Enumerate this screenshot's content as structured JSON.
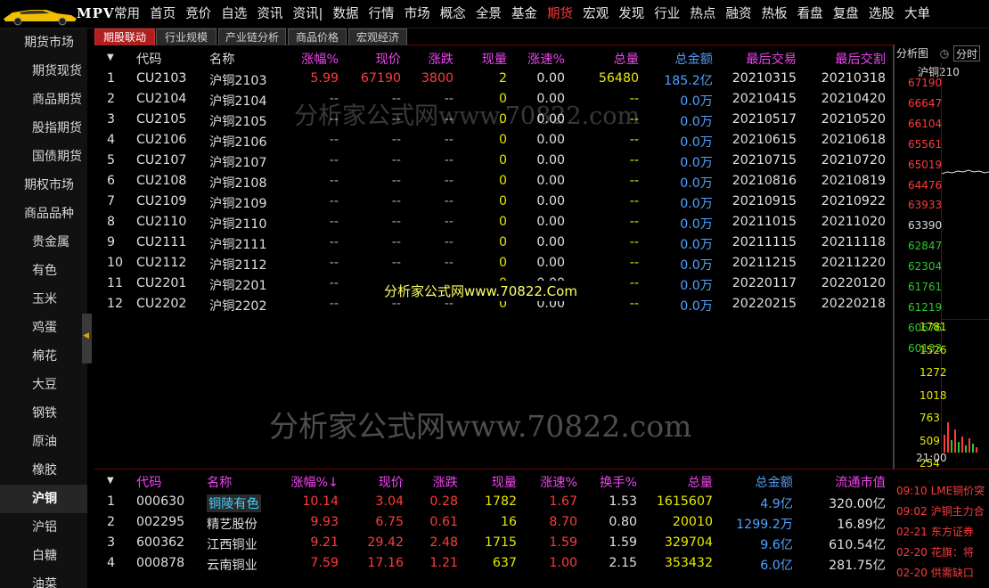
{
  "topbar": {
    "logo_text": "MPV",
    "menu": [
      {
        "label": "常用",
        "name": "menu-common"
      },
      {
        "label": "首页",
        "name": "menu-home"
      },
      {
        "label": "竞价",
        "name": "menu-bidding"
      },
      {
        "label": "自选",
        "name": "menu-watchlist"
      },
      {
        "label": "资讯",
        "name": "menu-info"
      },
      {
        "label": "资讯|",
        "name": "menu-info-2"
      },
      {
        "label": "数据",
        "name": "menu-data"
      },
      {
        "label": "行情",
        "name": "menu-quotes"
      },
      {
        "label": "市场",
        "name": "menu-market"
      },
      {
        "label": "概念",
        "name": "menu-concept"
      },
      {
        "label": "全景",
        "name": "menu-panorama"
      },
      {
        "label": "基金",
        "name": "menu-fund"
      },
      {
        "label": "期货",
        "name": "menu-futures",
        "active": true
      },
      {
        "label": "宏观",
        "name": "menu-macro"
      },
      {
        "label": "发现",
        "name": "menu-discover"
      },
      {
        "label": "行业",
        "name": "menu-industry"
      },
      {
        "label": "热点",
        "name": "menu-hotspot"
      },
      {
        "label": "融资",
        "name": "menu-margin"
      },
      {
        "label": "热板",
        "name": "menu-hot-board"
      },
      {
        "label": "看盘",
        "name": "menu-watch"
      },
      {
        "label": "复盘",
        "name": "menu-review"
      },
      {
        "label": "选股",
        "name": "menu-stock-picker"
      },
      {
        "label": "大单",
        "name": "menu-big-order"
      }
    ]
  },
  "sidebar": {
    "items": [
      {
        "label": "期货市场",
        "level": 1
      },
      {
        "label": "期货现货",
        "level": 2
      },
      {
        "label": "商品期货",
        "level": 2
      },
      {
        "label": "股指期货",
        "level": 2
      },
      {
        "label": "国债期货",
        "level": 2
      },
      {
        "label": "期权市场",
        "level": 1
      },
      {
        "label": "商品品种",
        "level": 1
      },
      {
        "label": "贵金属",
        "level": 2
      },
      {
        "label": "有色",
        "level": 2
      },
      {
        "label": "玉米",
        "level": 2
      },
      {
        "label": "鸡蛋",
        "level": 2
      },
      {
        "label": "棉花",
        "level": 2
      },
      {
        "label": "大豆",
        "level": 2
      },
      {
        "label": "钢铁",
        "level": 2
      },
      {
        "label": "原油",
        "level": 2
      },
      {
        "label": "橡胶",
        "level": 2
      },
      {
        "label": "沪铜",
        "level": 2,
        "active": true
      },
      {
        "label": "沪铝",
        "level": 2
      },
      {
        "label": "白糖",
        "level": 2
      },
      {
        "label": "油菜",
        "level": 2
      }
    ]
  },
  "tabs": [
    {
      "label": "期股联动",
      "active": true
    },
    {
      "label": "行业规模"
    },
    {
      "label": "产业链分析"
    },
    {
      "label": "商品价格"
    },
    {
      "label": "宏观经济"
    }
  ],
  "futures_table": {
    "sort_arrow": "▼",
    "headers": [
      "代码",
      "名称",
      "涨幅%",
      "现价",
      "涨跌",
      "现量",
      "涨速%",
      "总量",
      "总金额",
      "最后交易",
      "最后交割"
    ],
    "rows": [
      {
        "idx": "1",
        "code": "CU2103",
        "name": "沪铜2103",
        "pct": "5.99",
        "price": "67190",
        "chg": "3800",
        "vol": "2",
        "speed": "0.00",
        "total": "56480",
        "amount": "185.2亿",
        "last_trade": "20210315",
        "last_deliv": "20210318"
      },
      {
        "idx": "2",
        "code": "CU2104",
        "name": "沪铜2104",
        "pct": "--",
        "price": "--",
        "chg": "--",
        "vol": "0",
        "speed": "0.00",
        "total": "--",
        "amount": "0.0万",
        "last_trade": "20210415",
        "last_deliv": "20210420"
      },
      {
        "idx": "3",
        "code": "CU2105",
        "name": "沪铜2105",
        "pct": "--",
        "price": "--",
        "chg": "--",
        "vol": "0",
        "speed": "0.00",
        "total": "--",
        "amount": "0.0万",
        "last_trade": "20210517",
        "last_deliv": "20210520"
      },
      {
        "idx": "4",
        "code": "CU2106",
        "name": "沪铜2106",
        "pct": "--",
        "price": "--",
        "chg": "--",
        "vol": "0",
        "speed": "0.00",
        "total": "--",
        "amount": "0.0万",
        "last_trade": "20210615",
        "last_deliv": "20210618"
      },
      {
        "idx": "5",
        "code": "CU2107",
        "name": "沪铜2107",
        "pct": "--",
        "price": "--",
        "chg": "--",
        "vol": "0",
        "speed": "0.00",
        "total": "--",
        "amount": "0.0万",
        "last_trade": "20210715",
        "last_deliv": "20210720"
      },
      {
        "idx": "6",
        "code": "CU2108",
        "name": "沪铜2108",
        "pct": "--",
        "price": "--",
        "chg": "--",
        "vol": "0",
        "speed": "0.00",
        "total": "--",
        "amount": "0.0万",
        "last_trade": "20210816",
        "last_deliv": "20210819"
      },
      {
        "idx": "7",
        "code": "CU2109",
        "name": "沪铜2109",
        "pct": "--",
        "price": "--",
        "chg": "--",
        "vol": "0",
        "speed": "0.00",
        "total": "--",
        "amount": "0.0万",
        "last_trade": "20210915",
        "last_deliv": "20210922"
      },
      {
        "idx": "8",
        "code": "CU2110",
        "name": "沪铜2110",
        "pct": "--",
        "price": "--",
        "chg": "--",
        "vol": "0",
        "speed": "0.00",
        "total": "--",
        "amount": "0.0万",
        "last_trade": "20211015",
        "last_deliv": "20211020"
      },
      {
        "idx": "9",
        "code": "CU2111",
        "name": "沪铜2111",
        "pct": "--",
        "price": "--",
        "chg": "--",
        "vol": "0",
        "speed": "0.00",
        "total": "--",
        "amount": "0.0万",
        "last_trade": "20211115",
        "last_deliv": "20211118"
      },
      {
        "idx": "10",
        "code": "CU2112",
        "name": "沪铜2112",
        "pct": "--",
        "price": "--",
        "chg": "--",
        "vol": "0",
        "speed": "0.00",
        "total": "--",
        "amount": "0.0万",
        "last_trade": "20211215",
        "last_deliv": "20211220"
      },
      {
        "idx": "11",
        "code": "CU2201",
        "name": "沪铜2201",
        "pct": "--",
        "price": "--",
        "chg": "--",
        "vol": "0",
        "speed": "0.00",
        "total": "--",
        "amount": "0.0万",
        "last_trade": "20220117",
        "last_deliv": "20220120"
      },
      {
        "idx": "12",
        "code": "CU2202",
        "name": "沪铜2202",
        "pct": "--",
        "price": "--",
        "chg": "--",
        "vol": "0",
        "speed": "0.00",
        "total": "--",
        "amount": "0.0万",
        "last_trade": "20220215",
        "last_deliv": "20220218"
      }
    ]
  },
  "stocks_table": {
    "sort_arrow": "▼",
    "headers": [
      "代码",
      "名称",
      "涨幅%↓",
      "现价",
      "涨跌",
      "现量",
      "涨速%",
      "换手%",
      "总量",
      "总金额",
      "流通市值"
    ],
    "rows": [
      {
        "idx": "1",
        "code": "000630",
        "name": "铜陵有色",
        "pct": "10.14",
        "price": "3.04",
        "chg": "0.28",
        "vol": "1782",
        "speed": "1.67",
        "turnover": "1.53",
        "total": "1615607",
        "amount": "4.9亿",
        "mcap": "320.00亿"
      },
      {
        "idx": "2",
        "code": "002295",
        "name": "精艺股份",
        "pct": "9.93",
        "price": "6.75",
        "chg": "0.61",
        "vol": "16",
        "speed": "8.70",
        "turnover": "0.80",
        "total": "20010",
        "amount": "1299.2万",
        "mcap": "16.89亿"
      },
      {
        "idx": "3",
        "code": "600362",
        "name": "江西铜业",
        "pct": "9.21",
        "price": "29.42",
        "chg": "2.48",
        "vol": "1715",
        "speed": "1.59",
        "turnover": "1.59",
        "total": "329704",
        "amount": "9.6亿",
        "mcap": "610.54亿"
      },
      {
        "idx": "4",
        "code": "000878",
        "name": "云南铜业",
        "pct": "7.59",
        "price": "17.16",
        "chg": "1.21",
        "vol": "637",
        "speed": "1.00",
        "turnover": "2.15",
        "total": "353432",
        "amount": "6.0亿",
        "mcap": "281.75亿"
      }
    ]
  },
  "right_panel": {
    "tab1": "分析图",
    "tab2": "分时",
    "title": "沪铜210",
    "price_labels": [
      "67190",
      "66647",
      "66104",
      "65561",
      "65019",
      "64476",
      "63933",
      "63390",
      "62847",
      "62304",
      "61761",
      "61219",
      "60676",
      "60133"
    ],
    "volume_labels": [
      "1781",
      "1526",
      "1272",
      "1018",
      "763",
      "509",
      "254"
    ],
    "time_label": "21:00"
  },
  "news": [
    {
      "time": "09:10",
      "text": "LME铜价突"
    },
    {
      "time": "09:02",
      "text": "沪铜主力合"
    },
    {
      "time": "02-21",
      "text": "东方证券"
    },
    {
      "time": "02-20",
      "text": "花旗：将"
    },
    {
      "time": "02-20",
      "text": "供需缺口"
    }
  ],
  "watermarks": {
    "top": "分析家公式网www.70822.com",
    "middle": "分析家公式网www.70822.Com",
    "bottom": "分析家公式网www.70822.com"
  },
  "colors": {
    "active_tab": "#b01e1e",
    "up": "#ff3b3b",
    "volume_yellow": "#e8e800",
    "amount_blue": "#4fa3ff",
    "header_magenta": "#ee44ee",
    "header_blue": "#5599ee"
  }
}
